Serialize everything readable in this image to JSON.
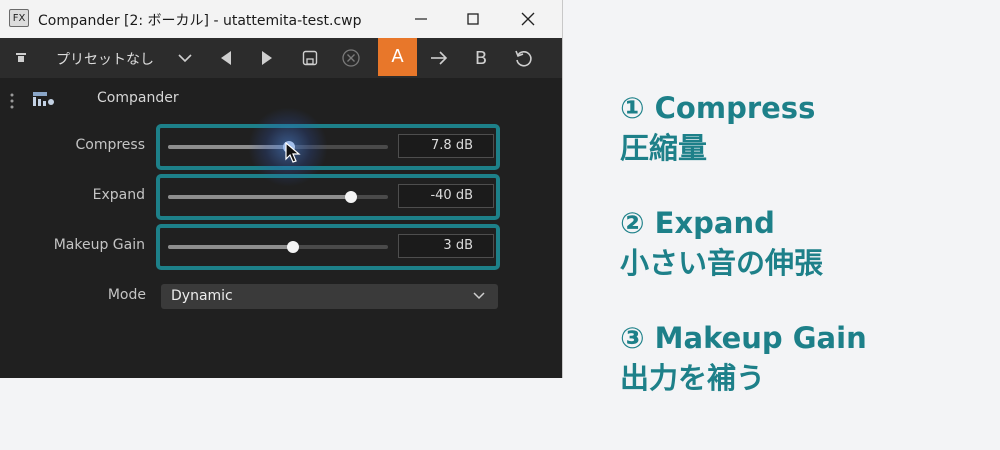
{
  "window": {
    "badge": "FX",
    "title": "Compander [2: ボーカル] - utattemita-test.cwp"
  },
  "toolbar": {
    "preset": "プリセットなし",
    "a_label": "A",
    "b_label": "B",
    "accent_color": "#e8772a"
  },
  "plugin": {
    "name": "Compander"
  },
  "params": [
    {
      "label": "Compress",
      "value": "7.8 dB",
      "level": 0.55
    },
    {
      "label": "Expand",
      "value": "-40 dB",
      "level": 0.83
    },
    {
      "label": "Makeup Gain",
      "value": "3 dB",
      "level": 0.57
    }
  ],
  "mode": {
    "label": "Mode",
    "value": "Dynamic"
  },
  "highlight_color": "#1d8089",
  "notes": [
    {
      "title": "① Compress",
      "desc": "圧縮量"
    },
    {
      "title": "② Expand",
      "desc": "小さい音の伸張"
    },
    {
      "title": "③ Makeup Gain",
      "desc": "出力を補う"
    }
  ]
}
